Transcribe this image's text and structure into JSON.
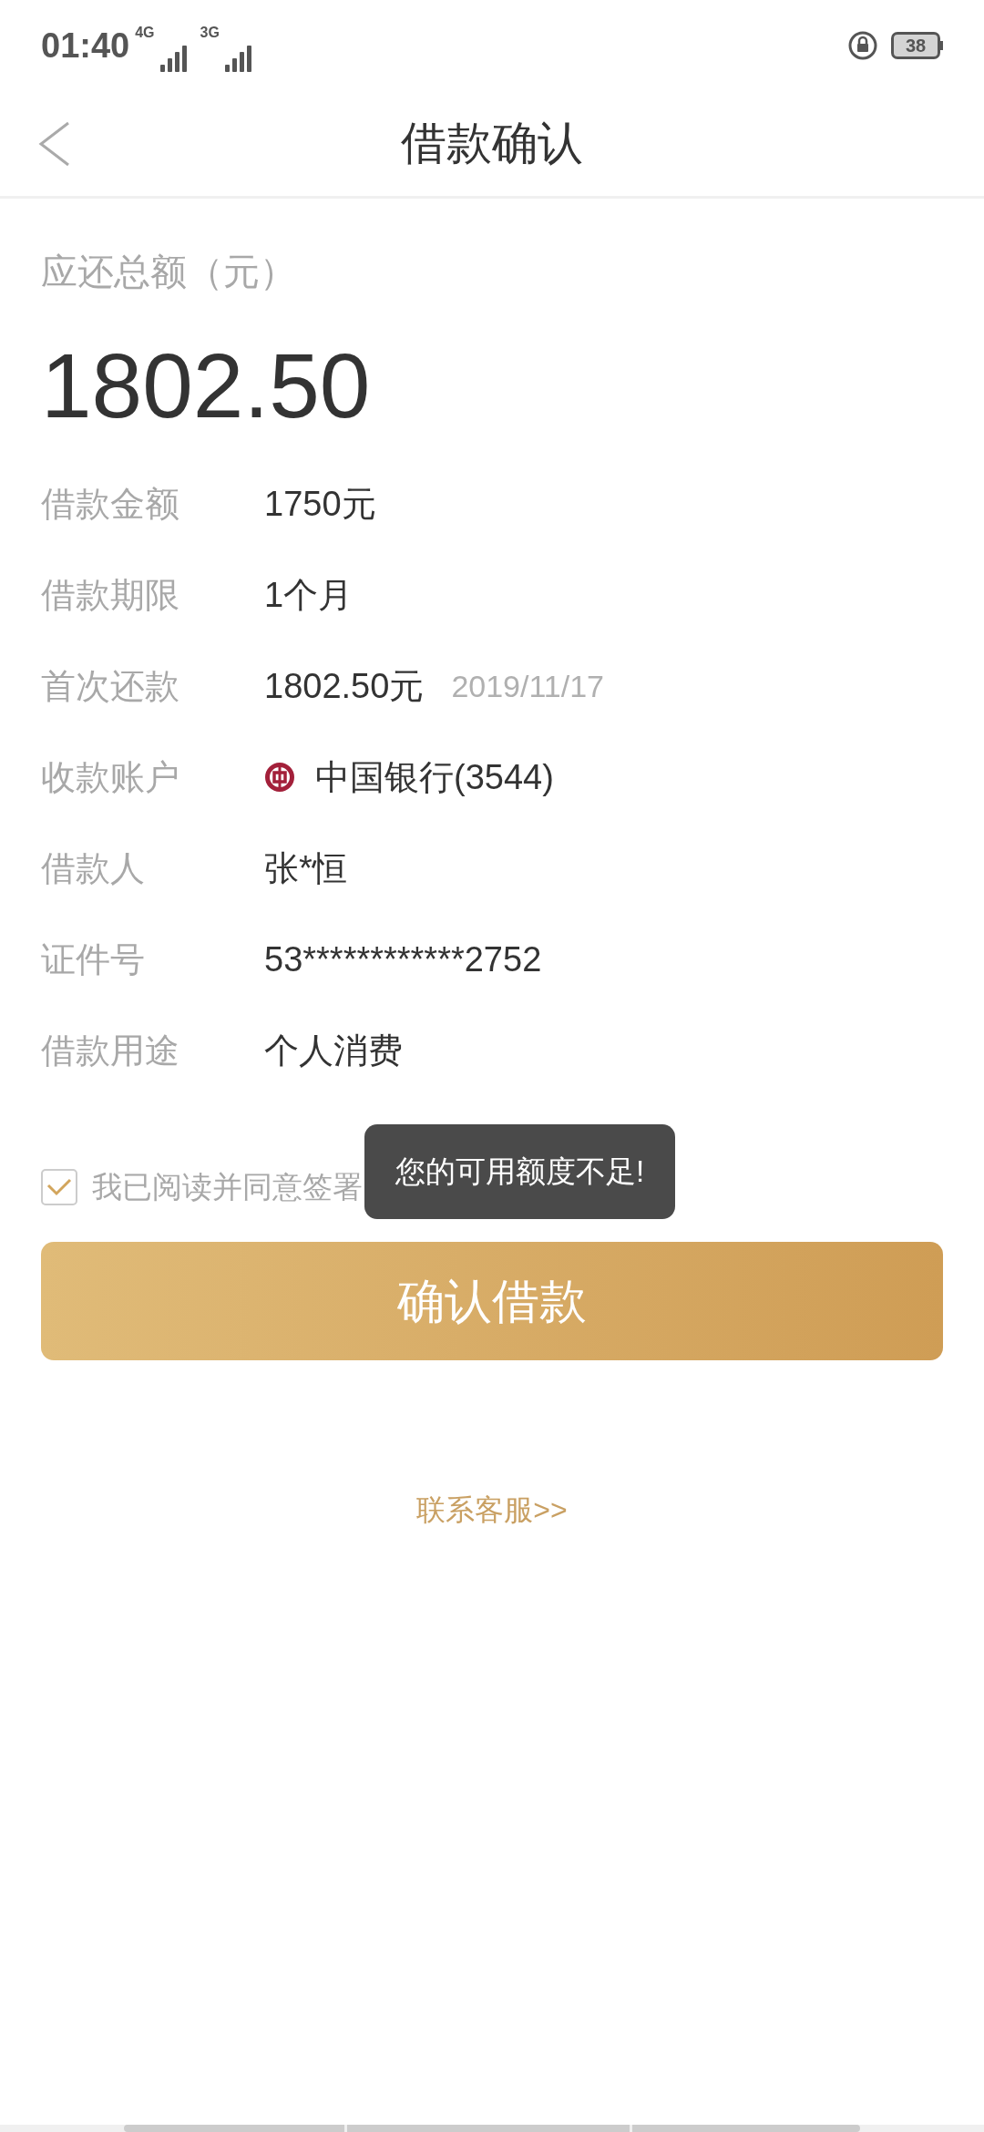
{
  "status_bar": {
    "time": "01:40",
    "network_1": "4G",
    "network_2": "3G",
    "battery": "38"
  },
  "header": {
    "title": "借款确认"
  },
  "total": {
    "label": "应还总额（元）",
    "amount": "1802.50"
  },
  "rows": [
    {
      "label": "借款金额",
      "value": "1750元"
    },
    {
      "label": "借款期限",
      "value": "1个月"
    },
    {
      "label": "首次还款",
      "value": "1802.50元",
      "note": "2019/11/17"
    },
    {
      "label": "收款账户",
      "value": "中国银行(3544)",
      "kind": "bank"
    },
    {
      "label": "借款人",
      "value": "张*恒"
    },
    {
      "label": "证件号",
      "value": "53************2752"
    },
    {
      "label": "借款用途",
      "value": "个人消费"
    }
  ],
  "agreement": {
    "checked": true,
    "text": "我已阅读并同意签署"
  },
  "toast": "您的可用额度不足!",
  "confirm_button": "确认借款",
  "contact_link": "联系客服>>"
}
